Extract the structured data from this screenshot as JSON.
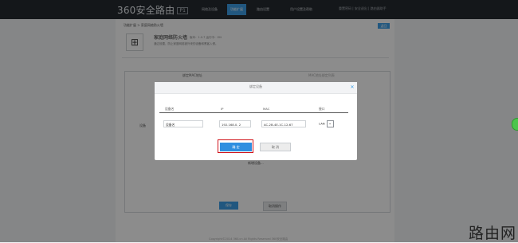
{
  "topbar": {
    "brand": "360安全路由",
    "brand_version": "P1",
    "nav": [
      {
        "label": "网络及设备"
      },
      {
        "label": "功能扩展"
      },
      {
        "label": "路由设置"
      },
      {
        "label": "用户设置及帮助"
      }
    ],
    "links": "重置密码  |  安全退出  |  路由器助手"
  },
  "breadcrumb": "功能扩展 > 家庭网络防火墙",
  "topright_button": "返回",
  "app": {
    "title": "家庭网络防火墙",
    "meta": "版本：1.0.7    运行中：ON",
    "desc": "通过设置，防止家庭网络被外来的设备和黑客入侵。"
  },
  "background": {
    "tab_title": "绑定MAC地址",
    "tab_right": "MAC地址绑定列表",
    "row_label": "设备",
    "add_link": "新增设备...",
    "save_label": "保存",
    "cancel_label": "取消操作",
    "footer": "Copyright©2014 360.cn All Rights Reserved 360安全路由"
  },
  "modal": {
    "title": "绑定设备",
    "columns": [
      "设备名",
      "IP",
      "MAC",
      "接口"
    ],
    "device_name": "设备名",
    "ip": "192.168.0. 2",
    "mac": "AC-2B-4E-1C-12-67",
    "interface": "LAN",
    "confirm_label": "确 定",
    "cancel_label": "取 消"
  },
  "watermark": "路由网"
}
